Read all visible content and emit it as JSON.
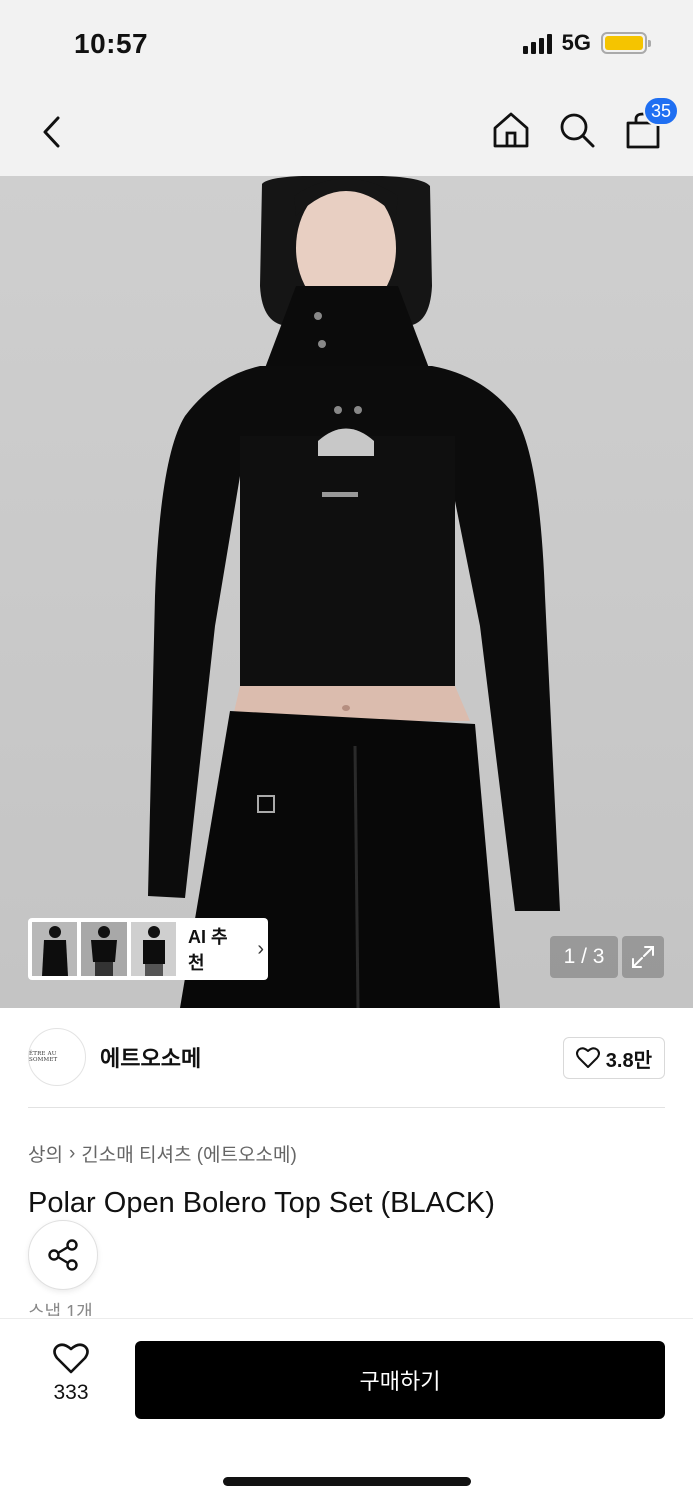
{
  "status_bar": {
    "time": "10:57",
    "network": "5G"
  },
  "nav": {
    "back_icon": "chevron-left-icon",
    "icons": [
      "home-icon",
      "search-icon",
      "shopping-bag-icon"
    ],
    "cart_badge": "35",
    "accent_color": "#1f6ff2"
  },
  "image": {
    "ai_label": "AI 추천",
    "ai_chevron": "›",
    "page_counter": "1 / 3"
  },
  "brand": {
    "logo_text": "ÊTRE AU SOMMET",
    "name": "에트오소메",
    "like_count": "3.8만"
  },
  "breadcrumb": {
    "items": [
      "상의",
      "긴소매 티셔츠 (에트오소메)"
    ],
    "separator": "›"
  },
  "product": {
    "title": "Polar Open Bolero Top Set (BLACK)",
    "snap_count": "스냅 1개"
  },
  "bottom_bar": {
    "wish_count": "333",
    "buy_label": "구매하기"
  }
}
